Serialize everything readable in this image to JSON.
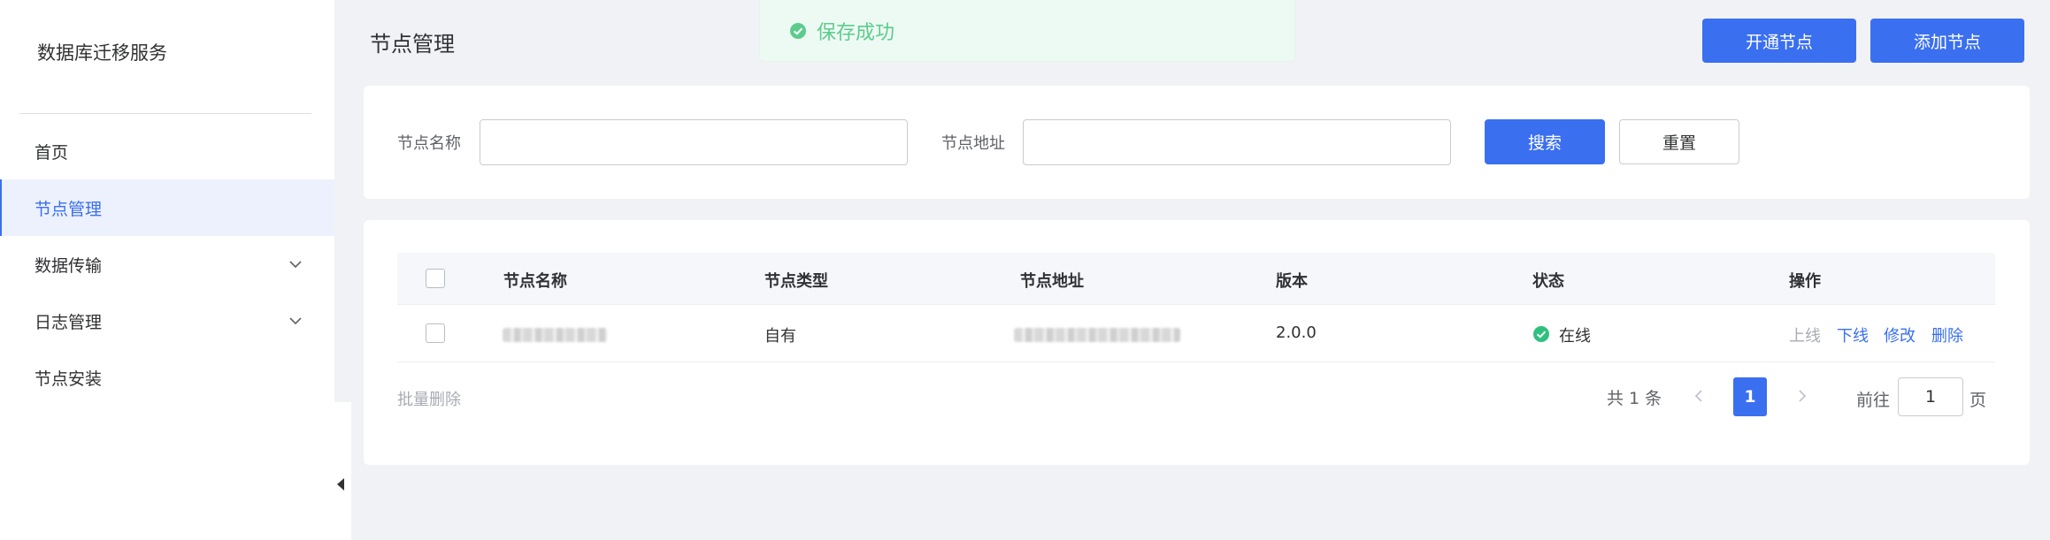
{
  "sidebar": {
    "brand": "数据库迁移服务",
    "items": [
      {
        "label": "首页"
      },
      {
        "label": "节点管理"
      },
      {
        "label": "数据传输"
      },
      {
        "label": "日志管理"
      },
      {
        "label": "节点安装"
      }
    ]
  },
  "header": {
    "title": "节点管理",
    "open_node_label": "开通节点",
    "add_node_label": "添加节点"
  },
  "toast": {
    "message": "保存成功",
    "icon": "check-circle-icon",
    "color": "#5ccc8c"
  },
  "search": {
    "name_label": "节点名称",
    "name_value": "",
    "address_label": "节点地址",
    "address_value": "",
    "search_label": "搜索",
    "reset_label": "重置"
  },
  "table": {
    "columns": [
      "节点名称",
      "节点类型",
      "节点地址",
      "版本",
      "状态",
      "操作"
    ],
    "rows": [
      {
        "type": "自有",
        "version": "2.0.0",
        "status": "在线",
        "actions": [
          "上线",
          "下线",
          "修改",
          "删除"
        ]
      }
    ]
  },
  "footer": {
    "batch_delete": "批量删除",
    "total": "共 1 条",
    "current_page": "1",
    "goto_label": "前往",
    "goto_value": "1",
    "goto_unit": "页"
  },
  "colors": {
    "primary": "#3a6ff0",
    "success": "#2fc07f",
    "active_bg": "#ecf1fd"
  }
}
